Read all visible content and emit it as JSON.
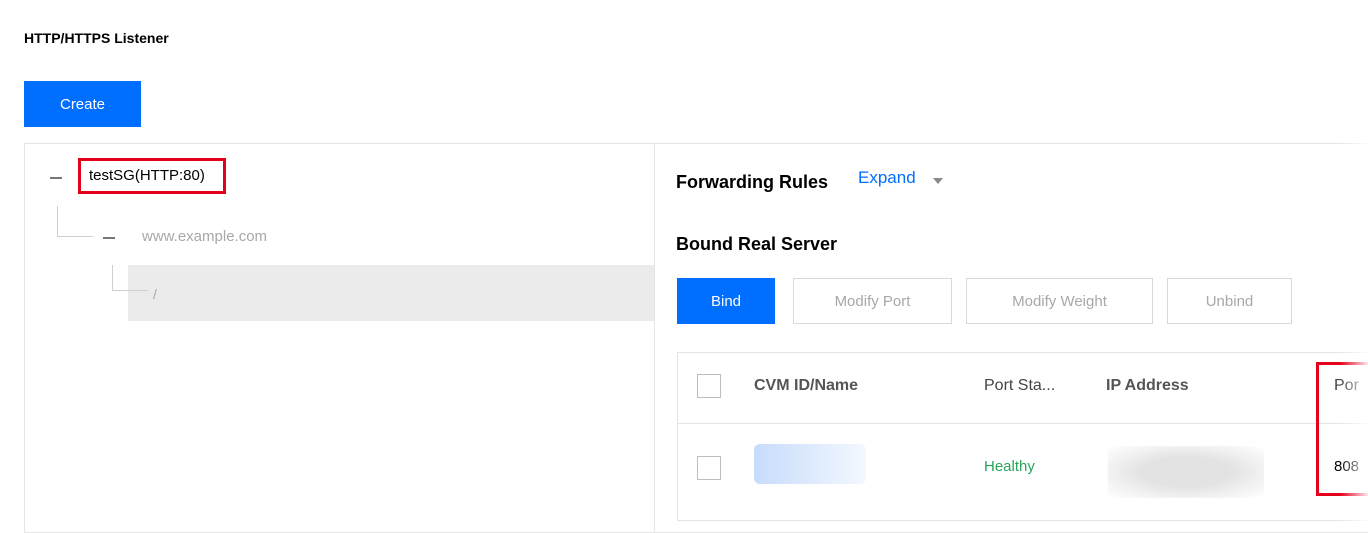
{
  "listener_section": {
    "title": "HTTP/HTTPS Listener",
    "create_label": "Create"
  },
  "tree": {
    "root_label": "testSG(HTTP:80)",
    "domain_label": "www.example.com",
    "path_label": "/"
  },
  "forwarding": {
    "title": "Forwarding Rules",
    "expand_label": "Expand"
  },
  "bound_server": {
    "title": "Bound Real Server",
    "buttons": {
      "bind": "Bind",
      "modify_port": "Modify Port",
      "modify_weight": "Modify Weight",
      "unbind": "Unbind"
    },
    "table": {
      "headers": {
        "cvm": "CVM ID/Name",
        "port_status": "Port Sta...",
        "ip": "IP Address",
        "port": "Por"
      },
      "rows": [
        {
          "port_status": "Healthy",
          "port": "808"
        }
      ]
    }
  },
  "colors": {
    "primary": "#006eff",
    "highlight_border": "#e5001c",
    "healthy": "#29a35a"
  }
}
